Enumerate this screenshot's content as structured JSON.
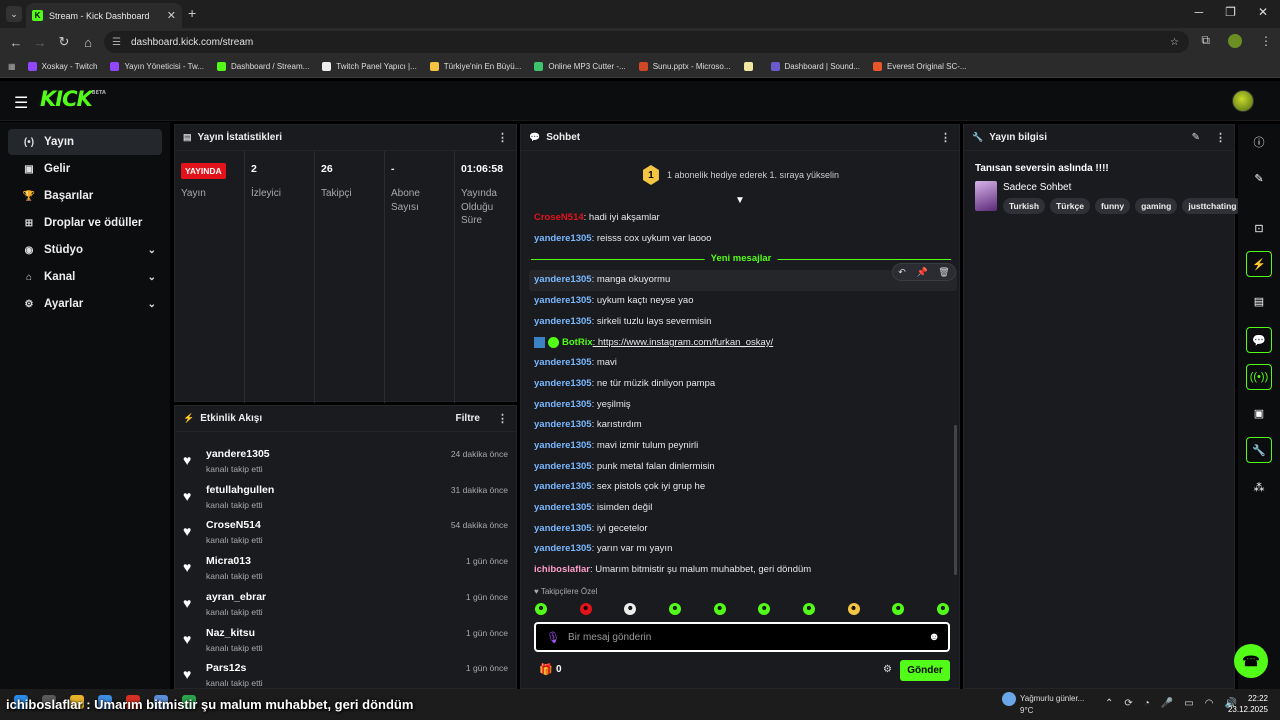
{
  "browser": {
    "tab_title": "Stream - Kick Dashboard",
    "url": "dashboard.kick.com/stream",
    "bookmarks": [
      {
        "label": "Xoskay - Twitch",
        "color": "#9146ff"
      },
      {
        "label": "Yayın Yöneticisi - Tw...",
        "color": "#9146ff"
      },
      {
        "label": "Dashboard / Stream...",
        "color": "#53fc18"
      },
      {
        "label": "Twitch Panel Yapıcı |...",
        "color": "#eeeeee"
      },
      {
        "label": "Türkiye'nin En Büyü...",
        "color": "#f4c542"
      },
      {
        "label": "Online MP3 Cutter -...",
        "color": "#3ec46d"
      },
      {
        "label": "Sunu.pptx - Microso...",
        "color": "#d24726"
      },
      {
        "label": "",
        "color": "#f1e7a0"
      },
      {
        "label": "Dashboard | Sound...",
        "color": "#6a5acd"
      },
      {
        "label": "Everest Original SC-...",
        "color": "#e8562a"
      }
    ]
  },
  "site": {
    "logo": "KICK",
    "logo_badge": "BETA"
  },
  "sidebar": {
    "items": [
      {
        "label": "Yayın",
        "icon": "broadcast-icon",
        "active": true,
        "chevron": false
      },
      {
        "label": "Gelir",
        "icon": "revenue-icon",
        "active": false,
        "chevron": false
      },
      {
        "label": "Başarılar",
        "icon": "trophy-icon",
        "active": false,
        "chevron": false
      },
      {
        "label": "Droplar ve ödüller",
        "icon": "gift-icon",
        "active": false,
        "chevron": false
      },
      {
        "label": "Stüdyo",
        "icon": "studio-icon",
        "active": false,
        "chevron": true
      },
      {
        "label": "Kanal",
        "icon": "channel-icon",
        "active": false,
        "chevron": true
      },
      {
        "label": "Ayarlar",
        "icon": "gear-icon",
        "active": false,
        "chevron": true
      }
    ]
  },
  "stats": {
    "title": "Yayın İstatistikleri",
    "live_badge": "YAYINDA",
    "items": [
      {
        "value": "",
        "label": "Yayın"
      },
      {
        "value": "2",
        "label": "İzleyici"
      },
      {
        "value": "26",
        "label": "Takipçi"
      },
      {
        "value": "-",
        "label": "Abone Sayısı"
      },
      {
        "value": "01:06:58",
        "label": "Yayında Olduğu Süre"
      }
    ]
  },
  "events": {
    "title": "Etkinlik Akışı",
    "filter_label": "Filtre",
    "items": [
      {
        "name": "yandere1305",
        "action": "kanalı takip etti",
        "time": "24 dakika önce"
      },
      {
        "name": "fetullahgullen",
        "action": "kanalı takip etti",
        "time": "31 dakika önce"
      },
      {
        "name": "CroseN514",
        "action": "kanalı takip etti",
        "time": "54 dakika önce"
      },
      {
        "name": "Micra013",
        "action": "kanalı takip etti",
        "time": "1 gün önce"
      },
      {
        "name": "ayran_ebrar",
        "action": "kanalı takip etti",
        "time": "1 gün önce"
      },
      {
        "name": "Naz_kitsu",
        "action": "kanalı takip etti",
        "time": "1 gün önce"
      },
      {
        "name": "Pars12s",
        "action": "kanalı takip etti",
        "time": "1 gün önce"
      }
    ]
  },
  "chat": {
    "title": "Sohbet",
    "gift_number": "1",
    "gift_text": "1 abonelik hediye ederek 1. sıraya yükselin",
    "new_messages_label": "Yeni mesajlar",
    "messages": [
      {
        "user": "CroseN514",
        "text": ": hadi iyi akşamlar",
        "color": "#e3131c"
      },
      {
        "user": "yandere1305",
        "text": ": reisss cox uykum var laooo",
        "color": "#7ab8ff"
      },
      {
        "user": "yandere1305",
        "text": ": manga okuyormu",
        "color": "#7ab8ff"
      },
      {
        "user": "yandere1305",
        "text": ": uykum kaçtı neyse yao",
        "color": "#7ab8ff"
      },
      {
        "user": "yandere1305",
        "text": ": sirkeli tuzlu lays severmisin",
        "color": "#7ab8ff"
      },
      {
        "user": "BotRix",
        "text": ": https://www.instagram.com/furkan_oskay/",
        "color": "#53fc18"
      },
      {
        "user": "yandere1305",
        "text": ": mavi",
        "color": "#7ab8ff"
      },
      {
        "user": "yandere1305",
        "text": ": ne tür müzik dinliyon pampa",
        "color": "#7ab8ff"
      },
      {
        "user": "yandere1305",
        "text": ": yeşilmiş",
        "color": "#7ab8ff"
      },
      {
        "user": "yandere1305",
        "text": ": karıstırdım",
        "color": "#7ab8ff"
      },
      {
        "user": "yandere1305",
        "text": ": mavi izmir tulum peynirli",
        "color": "#7ab8ff"
      },
      {
        "user": "yandere1305",
        "text": ": punk metal falan dinlermisin",
        "color": "#7ab8ff"
      },
      {
        "user": "yandere1305",
        "text": ": sex pistols çok iyi grup he",
        "color": "#7ab8ff"
      },
      {
        "user": "yandere1305",
        "text": ": isimden değil",
        "color": "#7ab8ff"
      },
      {
        "user": "yandere1305",
        "text": ": iyi gecetelor",
        "color": "#7ab8ff"
      },
      {
        "user": "yandere1305",
        "text": ": yarın var mı yayın",
        "color": "#7ab8ff"
      },
      {
        "user": "ichiboslaflar",
        "text": ": Umarım bitmistir şu malum muhabbet, geri döndüm",
        "color": "#ff9ecb"
      }
    ],
    "followers_only_label": "Takipçilere Özel",
    "input_placeholder": "Bir mesaj gönderin",
    "gift_count": "0",
    "send_label": "Gönder"
  },
  "info": {
    "title": "Yayın bilgisi",
    "stream_title": "Tanısan seversin aslında !!!!",
    "category": "Sadece Sohbet",
    "tags": [
      "Turkish",
      "Türkçe",
      "funny",
      "gaming",
      "justtchating"
    ]
  },
  "overlay_text": "ichiboslaflar : Umarım bitmistir şu malum muhabbet, geri döndüm",
  "taskbar": {
    "weather_text": "Yağmurlu günler...",
    "temperature": "9°C",
    "time": "22:22",
    "date": "23.12.2025"
  },
  "colors": {
    "accent": "#53fc18",
    "live": "#e3131c",
    "panel": "#191b1f"
  }
}
